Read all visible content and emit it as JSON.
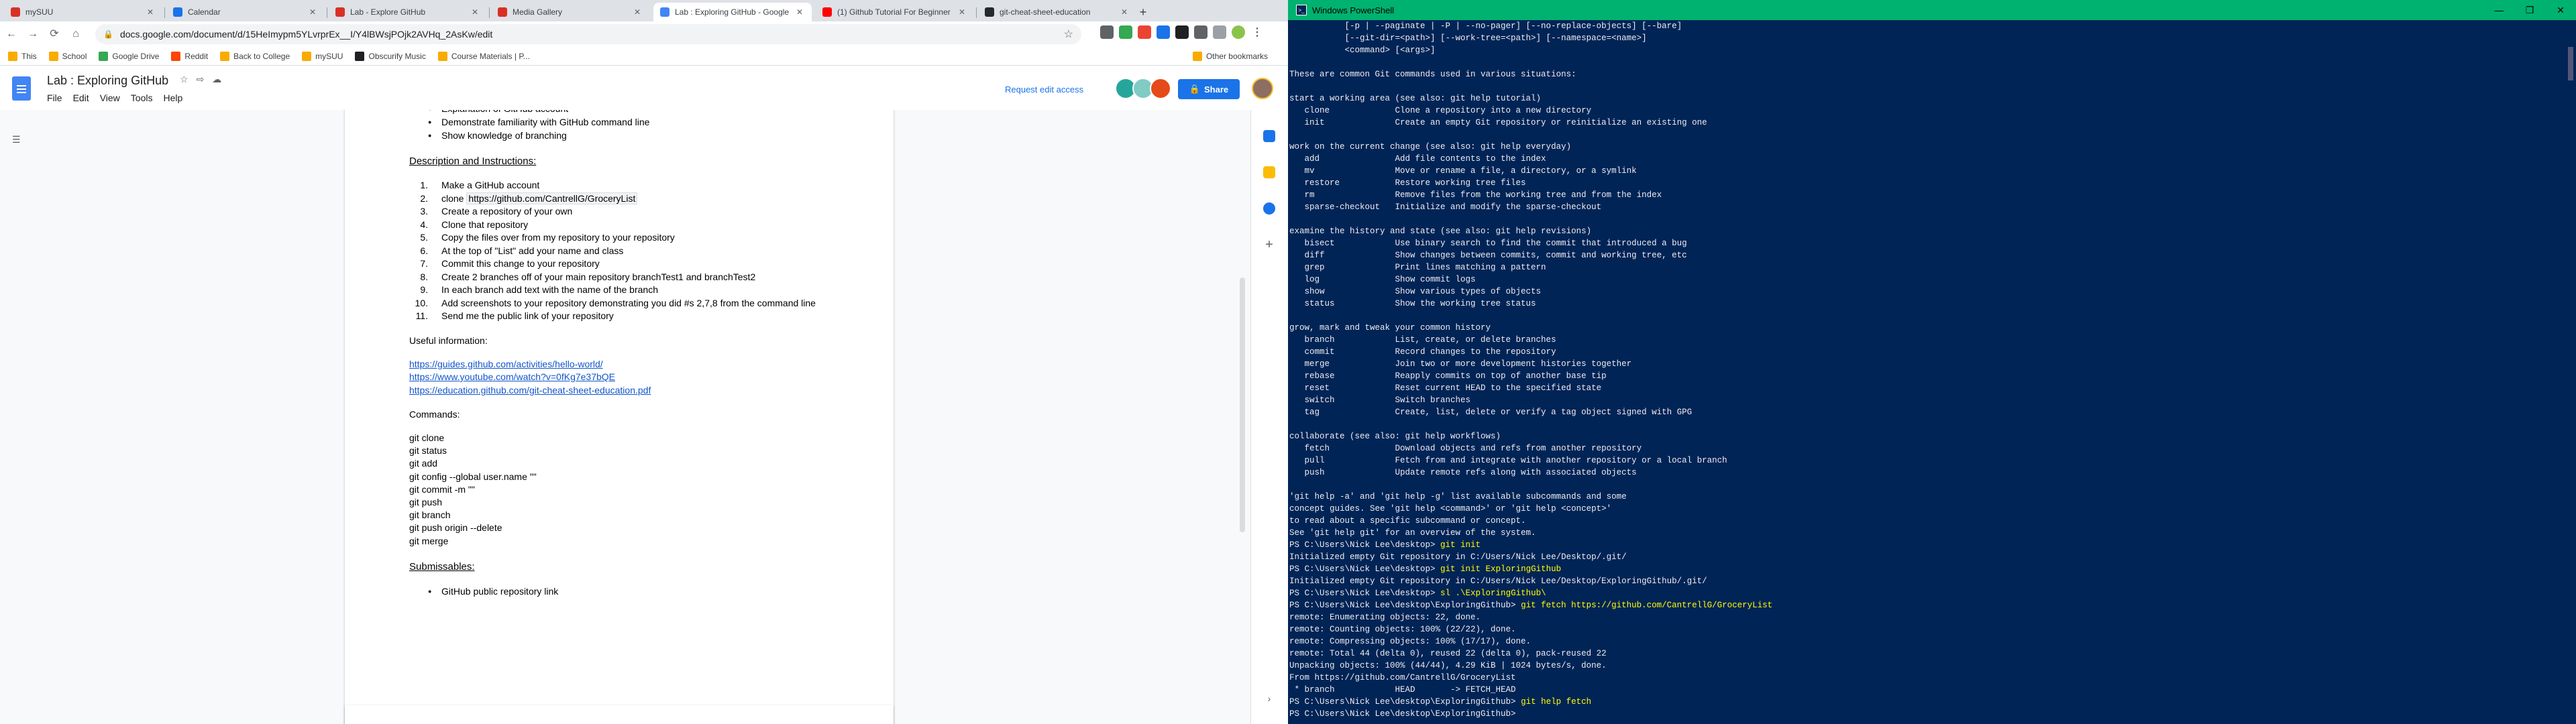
{
  "browser": {
    "tabs": [
      {
        "title": "mySUU",
        "color": "#d93025",
        "active": false
      },
      {
        "title": "Calendar",
        "color": "#1a73e8",
        "active": false
      },
      {
        "title": "Lab - Explore GitHub",
        "color": "#d93025",
        "active": false
      },
      {
        "title": "Media Gallery",
        "color": "#d93025",
        "active": false
      },
      {
        "title": "Lab : Exploring GitHub - Google",
        "color": "#4285f4",
        "active": true
      },
      {
        "title": "(1) Github Tutorial For Beginner",
        "color": "#ff0000",
        "active": false
      },
      {
        "title": "git-cheat-sheet-education",
        "color": "#24292e",
        "active": false
      }
    ],
    "url": "docs.google.com/document/d/15HeImypm5YLvrprEx__I/Y4lBWsjPOjk2AVHq_2AsKw/edit",
    "bookmarks": [
      "This",
      "School",
      "Google Drive",
      "Reddit",
      "Back to College",
      "mySUU",
      "Obscurify Music",
      "Course Materials | P..."
    ],
    "other_bookmarks": "Other bookmarks"
  },
  "docs": {
    "title": "Lab : Exploring GitHub",
    "menu": [
      "File",
      "Edit",
      "View",
      "Tools",
      "Help"
    ],
    "request_edit": "Request edit access",
    "share": "Share"
  },
  "document": {
    "top_bullets": [
      "Explanation of GitHub account",
      "Demonstrate familiarity with GitHub command line",
      "Show knowledge of branching"
    ],
    "desc_heading": "Description and Instructions:",
    "steps": [
      "Make a GitHub account",
      "clone",
      "Create a repository of your own",
      "Clone that repository",
      "Copy the files over from my repository to your repository",
      "At the top of \"List\" add your name and class",
      "Commit this change to your repository",
      "Create 2 branches off of your main repository branchTest1 and branchTest2",
      "In each branch add text with the name of the branch",
      "Add screenshots to your repository demonstrating you did #s 2,7,8 from the command line",
      "Send me the public link of your repository"
    ],
    "clone_url": "https://github.com/CantrellG/GroceryList",
    "useful_heading": "Useful information:",
    "links": [
      "https://guides.github.com/activities/hello-world/",
      "https://www.youtube.com/watch?v=0fKg7e37bQE",
      "https://education.github.com/git-cheat-sheet-education.pdf"
    ],
    "commands_heading": "Commands:",
    "commands": [
      "git clone",
      "git status",
      "git add",
      "git config --global user.name \"\"",
      "git commit -m \"\"",
      "git push",
      "git branch",
      "git push origin --delete",
      "git merge"
    ],
    "submissables_heading": "Submissables:",
    "submissables": [
      "GitHub public repository link"
    ]
  },
  "powershell": {
    "title": "Windows PowerShell",
    "lines": [
      {
        "t": "           [-p | --paginate | -P | --no-pager] [--no-replace-objects] [--bare]"
      },
      {
        "t": "           [--git-dir=<path>] [--work-tree=<path>] [--namespace=<name>]"
      },
      {
        "t": "           <command> [<args>]"
      },
      {
        "t": ""
      },
      {
        "t": "These are common Git commands used in various situations:"
      },
      {
        "t": ""
      },
      {
        "t": "start a working area (see also: git help tutorial)"
      },
      {
        "t": "   clone             Clone a repository into a new directory"
      },
      {
        "t": "   init              Create an empty Git repository or reinitialize an existing one"
      },
      {
        "t": ""
      },
      {
        "t": "work on the current change (see also: git help everyday)"
      },
      {
        "t": "   add               Add file contents to the index"
      },
      {
        "t": "   mv                Move or rename a file, a directory, or a symlink"
      },
      {
        "t": "   restore           Restore working tree files"
      },
      {
        "t": "   rm                Remove files from the working tree and from the index"
      },
      {
        "t": "   sparse-checkout   Initialize and modify the sparse-checkout"
      },
      {
        "t": ""
      },
      {
        "t": "examine the history and state (see also: git help revisions)"
      },
      {
        "t": "   bisect            Use binary search to find the commit that introduced a bug"
      },
      {
        "t": "   diff              Show changes between commits, commit and working tree, etc"
      },
      {
        "t": "   grep              Print lines matching a pattern"
      },
      {
        "t": "   log               Show commit logs"
      },
      {
        "t": "   show              Show various types of objects"
      },
      {
        "t": "   status            Show the working tree status"
      },
      {
        "t": ""
      },
      {
        "t": "grow, mark and tweak your common history"
      },
      {
        "t": "   branch            List, create, or delete branches"
      },
      {
        "t": "   commit            Record changes to the repository"
      },
      {
        "t": "   merge             Join two or more development histories together"
      },
      {
        "t": "   rebase            Reapply commits on top of another base tip"
      },
      {
        "t": "   reset             Reset current HEAD to the specified state"
      },
      {
        "t": "   switch            Switch branches"
      },
      {
        "t": "   tag               Create, list, delete or verify a tag object signed with GPG"
      },
      {
        "t": ""
      },
      {
        "t": "collaborate (see also: git help workflows)"
      },
      {
        "t": "   fetch             Download objects and refs from another repository"
      },
      {
        "t": "   pull              Fetch from and integrate with another repository or a local branch"
      },
      {
        "t": "   push              Update remote refs along with associated objects"
      },
      {
        "t": ""
      },
      {
        "t": "'git help -a' and 'git help -g' list available subcommands and some"
      },
      {
        "t": "concept guides. See 'git help <command>' or 'git help <concept>'"
      },
      {
        "t": "to read about a specific subcommand or concept."
      },
      {
        "t": "See 'git help git' for an overview of the system."
      },
      {
        "p": "PS C:\\Users\\Nick Lee\\desktop> ",
        "c": "git init"
      },
      {
        "t": "Initialized empty Git repository in C:/Users/Nick Lee/Desktop/.git/"
      },
      {
        "p": "PS C:\\Users\\Nick Lee\\desktop> ",
        "c": "git init ExploringGithub"
      },
      {
        "t": "Initialized empty Git repository in C:/Users/Nick Lee/Desktop/ExploringGithub/.git/"
      },
      {
        "p": "PS C:\\Users\\Nick Lee\\desktop> ",
        "c": "sl .\\ExploringGithub\\"
      },
      {
        "p": "PS C:\\Users\\Nick Lee\\desktop\\ExploringGithub> ",
        "c": "git fetch https://github.com/CantrellG/GroceryList"
      },
      {
        "t": "remote: Enumerating objects: 22, done."
      },
      {
        "t": "remote: Counting objects: 100% (22/22), done."
      },
      {
        "t": "remote: Compressing objects: 100% (17/17), done."
      },
      {
        "t": "remote: Total 44 (delta 0), reused 22 (delta 0), pack-reused 22"
      },
      {
        "t": "Unpacking objects: 100% (44/44), 4.29 KiB | 1024 bytes/s, done."
      },
      {
        "t": "From https://github.com/CantrellG/GroceryList"
      },
      {
        "t": " * branch            HEAD       -> FETCH_HEAD"
      },
      {
        "p": "PS C:\\Users\\Nick Lee\\desktop\\ExploringGithub> ",
        "c": "git help fetch"
      },
      {
        "p": "PS C:\\Users\\Nick Lee\\desktop\\ExploringGithub> ",
        "c": ""
      }
    ]
  }
}
